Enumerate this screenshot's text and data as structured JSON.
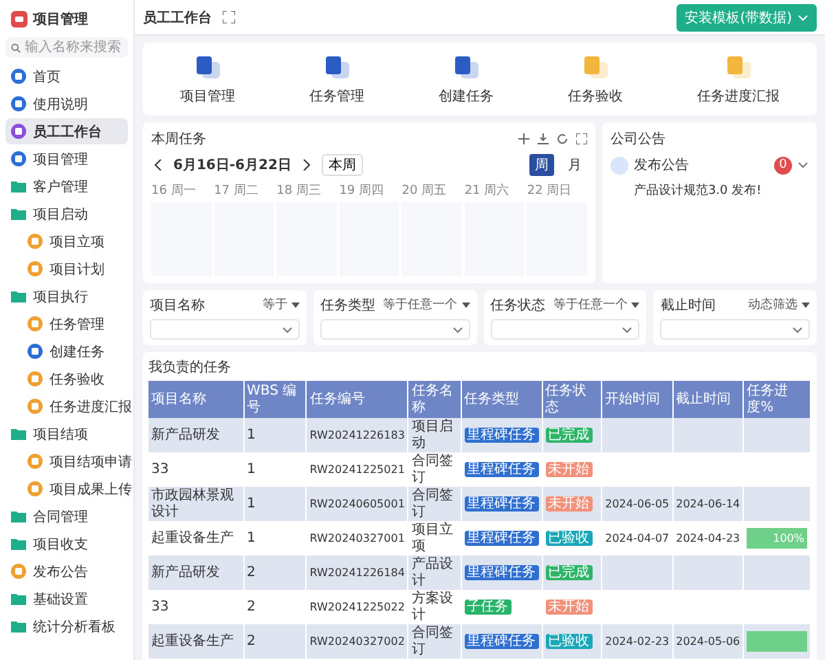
{
  "sidebar": {
    "title": "项目管理",
    "search": {
      "placeholder": "输入名称来搜索"
    },
    "items": [
      {
        "label": "首页",
        "kind": "page",
        "color": "#2b6fd6",
        "selected": false
      },
      {
        "label": "使用说明",
        "kind": "page",
        "color": "#2b6fd6",
        "selected": false
      },
      {
        "label": "员工工作台",
        "kind": "page",
        "color": "#8a4fd8",
        "selected": true
      },
      {
        "label": "项目管理",
        "kind": "page",
        "color": "#2b6fd6",
        "selected": false
      },
      {
        "label": "客户管理",
        "kind": "group",
        "selected": false
      },
      {
        "label": "项目启动",
        "kind": "group",
        "selected": false,
        "children": [
          {
            "label": "项目立项",
            "kind": "page",
            "color": "#f0a030",
            "selected": false
          },
          {
            "label": "项目计划",
            "kind": "page",
            "color": "#f0a030",
            "selected": false
          }
        ]
      },
      {
        "label": "项目执行",
        "kind": "group",
        "selected": false,
        "children": [
          {
            "label": "任务管理",
            "kind": "page",
            "color": "#f0a030",
            "selected": false
          },
          {
            "label": "创建任务",
            "kind": "page",
            "color": "#2b6fd6",
            "selected": false
          },
          {
            "label": "任务验收",
            "kind": "page",
            "color": "#f0a030",
            "selected": false
          },
          {
            "label": "任务进度汇报",
            "kind": "page",
            "color": "#f0a030",
            "selected": false
          }
        ]
      },
      {
        "label": "项目结项",
        "kind": "group",
        "selected": false,
        "children": [
          {
            "label": "项目结项申请",
            "kind": "page",
            "color": "#f0a030",
            "selected": false
          },
          {
            "label": "项目成果上传",
            "kind": "page",
            "color": "#f0a030",
            "selected": false
          }
        ]
      },
      {
        "label": "合同管理",
        "kind": "group",
        "selected": false
      },
      {
        "label": "项目收支",
        "kind": "group",
        "selected": false
      },
      {
        "label": "发布公告",
        "kind": "page",
        "color": "#f0a030",
        "selected": false
      },
      {
        "label": "基础设置",
        "kind": "group",
        "selected": false
      },
      {
        "label": "统计分析看板",
        "kind": "group",
        "selected": false
      }
    ]
  },
  "header": {
    "title": "员工工作台",
    "button": "安装模板(带数据)"
  },
  "shortcuts": [
    {
      "label": "项目管理",
      "color": "#2b5cc4"
    },
    {
      "label": "任务管理",
      "color": "#2b5cc4"
    },
    {
      "label": "创建任务",
      "color": "#2b5cc4"
    },
    {
      "label": "任务验收",
      "color": "#f2b63c"
    },
    {
      "label": "任务进度汇报",
      "color": "#f2b63c"
    }
  ],
  "calendar": {
    "title": "本周任务",
    "range": "6月16日-6月22日",
    "today": "本周",
    "views": [
      {
        "label": "周",
        "selected": true
      },
      {
        "label": "月",
        "selected": false
      }
    ],
    "days": [
      "16 周一",
      "17 周二",
      "18 周三",
      "19 周四",
      "20 周五",
      "21 周六",
      "22 周日"
    ]
  },
  "notice": {
    "title": "公司公告",
    "author": "发布公告",
    "badge": "0",
    "text": "产品设计规范3.0 发布!"
  },
  "filters": [
    {
      "label": "项目名称",
      "operator": "等于"
    },
    {
      "label": "任务类型",
      "operator": "等于任意一个"
    },
    {
      "label": "任务状态",
      "operator": "等于任意一个"
    },
    {
      "label": "截止时间",
      "operator": "动态筛选"
    }
  ],
  "table": {
    "title": "我负责的任务",
    "columns": [
      "项目名称",
      "WBS 编号",
      "任务编号",
      "任务名称",
      "任务类型",
      "任务状态",
      "开始时间",
      "截止时间",
      "任务进度%"
    ],
    "rows": [
      {
        "project": "新产品研发",
        "wbs": "1",
        "code": "RW20241226183",
        "name": "项目启动",
        "type": {
          "label": "里程碑任务",
          "color": "#2f6fd0"
        },
        "status": {
          "label": "已完成",
          "color": "#2fb56a"
        }
      },
      {
        "project": "33",
        "wbs": "1",
        "code": "RW20241225021",
        "name": "合同签订",
        "type": {
          "label": "里程碑任务",
          "color": "#2f6fd0"
        },
        "status": {
          "label": "未开始",
          "color": "#f2907a"
        }
      },
      {
        "project": "市政园林景观设计",
        "wbs": "1",
        "code": "RW20240605001",
        "name": "合同签订",
        "type": {
          "label": "里程碑任务",
          "color": "#2f6fd0"
        },
        "status": {
          "label": "未开始",
          "color": "#f2907a"
        },
        "start": "2024-06-05",
        "end": "2024-06-14"
      },
      {
        "project": "起重设备生产",
        "wbs": "1",
        "code": "RW20240327001",
        "name": "项目立项",
        "type": {
          "label": "里程碑任务",
          "color": "#2f6fd0"
        },
        "status": {
          "label": "已验收",
          "color": "#1aa7b8"
        },
        "start": "2024-04-07",
        "end": "2024-04-23",
        "progress": {
          "level": 1,
          "reading": "100%"
        }
      },
      {
        "project": "新产品研发",
        "wbs": "2",
        "code": "RW20241226184",
        "name": "产品设计",
        "type": {
          "label": "里程碑任务",
          "color": "#2f6fd0"
        },
        "status": {
          "label": "已完成",
          "color": "#2fb56a"
        }
      },
      {
        "project": "33",
        "wbs": "2",
        "code": "RW20241225022",
        "name": "方案设计",
        "type": {
          "label": "子任务",
          "color": "#27b36a"
        },
        "status": {
          "label": "未开始",
          "color": "#f2907a"
        }
      },
      {
        "project": "起重设备生产",
        "wbs": "2",
        "code": "RW20240327002",
        "name": "合同签订",
        "type": {
          "label": "里程碑任务",
          "color": "#2f6fd0"
        },
        "status": {
          "label": "已验收",
          "color": "#1aa7b8"
        },
        "start": "2024-02-23",
        "end": "2024-05-06",
        "progress": {
          "level": 1
        }
      }
    ]
  }
}
